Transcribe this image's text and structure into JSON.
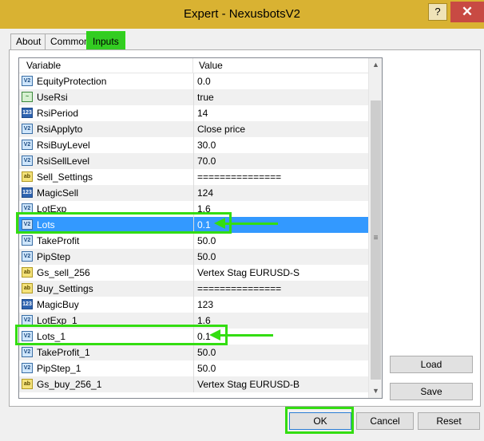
{
  "window": {
    "title": "Expert - NexusbotsV2",
    "help_label": "?",
    "close_label": "✕"
  },
  "tabs": [
    {
      "label": "About"
    },
    {
      "label": "Common"
    },
    {
      "label": "Inputs",
      "active": true
    }
  ],
  "grid": {
    "headers": {
      "variable": "Variable",
      "value": "Value"
    },
    "rows": [
      {
        "name": "EquityProtection",
        "value": "0.0",
        "type": "double"
      },
      {
        "name": "UseRsi",
        "value": "true",
        "type": "bool"
      },
      {
        "name": "RsiPeriod",
        "value": "14",
        "type": "int"
      },
      {
        "name": "RsiApplyto",
        "value": "Close price",
        "type": "double"
      },
      {
        "name": "RsiBuyLevel",
        "value": "30.0",
        "type": "double"
      },
      {
        "name": "RsiSellLevel",
        "value": "70.0",
        "type": "double"
      },
      {
        "name": "Sell_Settings",
        "value": "===============",
        "type": "string"
      },
      {
        "name": "MagicSell",
        "value": "124",
        "type": "int"
      },
      {
        "name": "LotExp",
        "value": "1.6",
        "type": "double"
      },
      {
        "name": "Lots",
        "value": "0.1",
        "type": "double",
        "selected": true
      },
      {
        "name": "TakeProfit",
        "value": "50.0",
        "type": "double"
      },
      {
        "name": "PipStep",
        "value": "50.0",
        "type": "double"
      },
      {
        "name": "Gs_sell_256",
        "value": "Vertex Stag EURUSD-S",
        "type": "string"
      },
      {
        "name": "Buy_Settings",
        "value": "===============",
        "type": "string"
      },
      {
        "name": "MagicBuy",
        "value": "123",
        "type": "int"
      },
      {
        "name": "LotExp_1",
        "value": "1.6",
        "type": "double"
      },
      {
        "name": "Lots_1",
        "value": "0.1",
        "type": "double"
      },
      {
        "name": "TakeProfit_1",
        "value": "50.0",
        "type": "double"
      },
      {
        "name": "PipStep_1",
        "value": "50.0",
        "type": "double"
      },
      {
        "name": "Gs_buy_256_1",
        "value": "Vertex Stag EURUSD-B",
        "type": "string"
      }
    ]
  },
  "icons": {
    "double": "V2",
    "int": "123",
    "string": "ab",
    "bool": "~"
  },
  "buttons": {
    "load": "Load",
    "save": "Save",
    "ok": "OK",
    "cancel": "Cancel",
    "reset": "Reset"
  },
  "colors": {
    "title_bar": "#d9b232",
    "selection": "#3399ff",
    "highlight": "#33dd11",
    "close": "#c84a43"
  }
}
